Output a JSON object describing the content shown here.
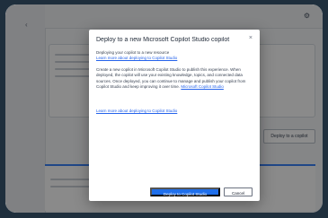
{
  "dialog": {
    "title": "Deploy to a new Microsoft Copilot Studio copilot",
    "meta_line": "Deploying your copilot to a new resource",
    "meta_link": "Learn more about deploying to Copilot Studio",
    "body_text": "Create a new copilot in Microsoft Copilot Studio to publish this experience. When deployed, the copilot will use your existing knowledge, topics, and connected data sources. Once deployed, you can continue to manage and publish your copilot from Copilot Studio and keep improving it over time.",
    "body_link": "Microsoft Copilot Studio",
    "learn_more": "Learn more about deploying to Copilot Studio",
    "close_glyph": "×",
    "primary_button": "Deploy to Copilot Studio",
    "secondary_button": "Cancel"
  },
  "background": {
    "behind_button": "Deploy to a copilot"
  },
  "icons": {
    "close": "close-icon",
    "sidebar_chevron": "chevron-left-icon",
    "toolbar": "tool-icon"
  },
  "colors": {
    "primary": "#1f6feb",
    "link": "#2563eb",
    "overlay": "rgba(0,0,0,0.45)",
    "frame": "#1f2f3d"
  }
}
